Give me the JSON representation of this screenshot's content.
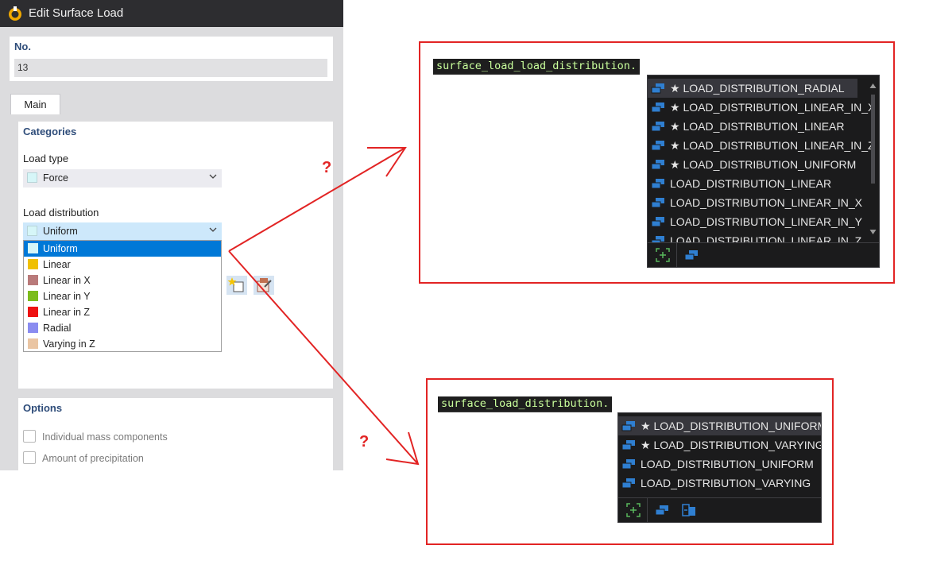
{
  "dialog": {
    "title": "Edit Surface Load",
    "no_label": "No.",
    "no_value": "13",
    "tab_main": "Main",
    "categories_title": "Categories",
    "load_type_label": "Load type",
    "load_type_value": "Force",
    "load_type_color": "#d6f6f8",
    "load_distribution_label": "Load distribution",
    "load_distribution_value": "Uniform",
    "load_distribution_color": "#d6f6f8",
    "dropdown_items": [
      {
        "label": "Uniform",
        "color": "#d6f6f8",
        "selected": true
      },
      {
        "label": "Linear",
        "color": "#f0c000"
      },
      {
        "label": "Linear in X",
        "color": "#b97a7a"
      },
      {
        "label": "Linear in Y",
        "color": "#7cbc1c"
      },
      {
        "label": "Linear in Z",
        "color": "#ee1111"
      },
      {
        "label": "Radial",
        "color": "#8a8cf0"
      },
      {
        "label": "Varying in Z",
        "color": "#eac5a3"
      }
    ],
    "options_title": "Options",
    "options": [
      {
        "label": "Individual mass components",
        "checked": false
      },
      {
        "label": "Amount of precipitation",
        "checked": false
      }
    ]
  },
  "callout_top": {
    "code": "surface_load_load_distribution.",
    "items": [
      {
        "label": "★ LOAD_DISTRIBUTION_RADIAL",
        "highlight": true
      },
      {
        "label": "★ LOAD_DISTRIBUTION_LINEAR_IN_X"
      },
      {
        "label": "★ LOAD_DISTRIBUTION_LINEAR"
      },
      {
        "label": "★ LOAD_DISTRIBUTION_LINEAR_IN_Z"
      },
      {
        "label": "★ LOAD_DISTRIBUTION_UNIFORM"
      },
      {
        "label": "LOAD_DISTRIBUTION_LINEAR"
      },
      {
        "label": "LOAD_DISTRIBUTION_LINEAR_IN_X"
      },
      {
        "label": "LOAD_DISTRIBUTION_LINEAR_IN_Y"
      },
      {
        "label": "LOAD_DISTRIBUTION_LINEAR_IN_Z"
      }
    ]
  },
  "callout_bottom": {
    "code": "surface_load_distribution.",
    "items": [
      {
        "label": "★ LOAD_DISTRIBUTION_UNIFORM",
        "highlight": true
      },
      {
        "label": "★ LOAD_DISTRIBUTION_VARYING"
      },
      {
        "label": "LOAD_DISTRIBUTION_UNIFORM"
      },
      {
        "label": "LOAD_DISTRIBUTION_VARYING"
      }
    ]
  },
  "annotations": {
    "question_mark": "?",
    "accent_color": "#e22424"
  }
}
